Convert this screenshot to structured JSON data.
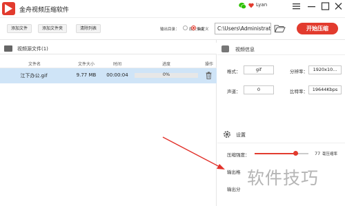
{
  "window": {
    "title": "金舟视频压缩软件",
    "user": "Lyan"
  },
  "toolbar": {
    "add_file": "添加文件",
    "add_folder": "添加文件夹",
    "clear_list": "清除列表",
    "output_dir_label": "输出目录：",
    "option_source": "原文件夹",
    "option_custom": "自定义",
    "output_path": "C:\\Users\\Administrator\\",
    "start": "开始压缩"
  },
  "file_list": {
    "header": "视频源文件(1)",
    "columns": [
      "文件名",
      "文件大小",
      "时间",
      "进度",
      "操作"
    ],
    "rows": [
      {
        "name": "江下办公.gif",
        "size": "9.77 MB",
        "time": "00:00:04",
        "progress": "0%",
        "progress_value": 0
      }
    ]
  },
  "video_info": {
    "header": "视频信息",
    "format_label": "格式：",
    "format_value": "gif",
    "resolution_label": "分辨率：",
    "resolution_value": "1920x10...",
    "audio_label": "声道：",
    "audio_value": "0",
    "bitrate_label": "比特率：",
    "bitrate_value": "19644Kbps"
  },
  "settings": {
    "header": "设置",
    "compress_label": "压缩强度：",
    "compress_value": "77",
    "compress_suffix": "毫压缩率",
    "compress_level": 0.77,
    "output_label_1": "输出格",
    "output_label_2": "输出分"
  },
  "watermark": "软件技巧",
  "colors": {
    "accent": "#e23b2e",
    "selected_row": "#cfe4f7"
  }
}
